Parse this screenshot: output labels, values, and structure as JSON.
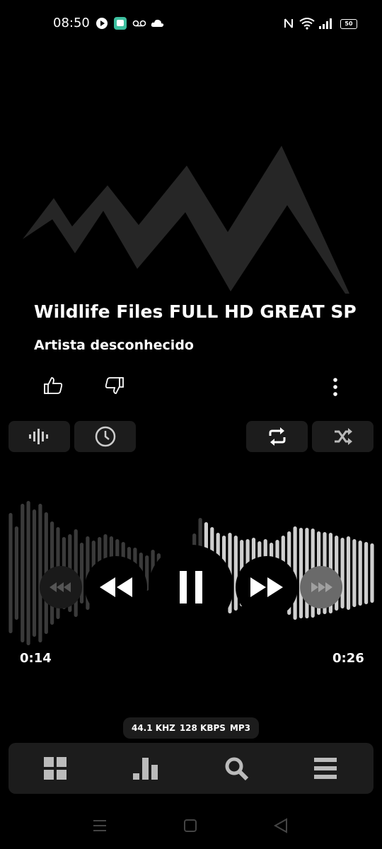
{
  "status_bar": {
    "time": "08:50",
    "battery": "50"
  },
  "track": {
    "title": "Wildlife Files FULL HD GREAT SP",
    "artist": "Artista desconhecido"
  },
  "playback": {
    "elapsed": "0:14",
    "total": "0:26",
    "progress": 0.54,
    "state": "playing"
  },
  "audio_info": {
    "sample_rate": "44.1 KHZ",
    "bitrate": "128 KBPS",
    "format": "MP3"
  },
  "colors": {
    "background": "#000000",
    "surface": "#1c1c1c",
    "played_wave": "#3a3a3a",
    "unplayed_wave": "#cfcfcf",
    "icon": "#cccccc"
  },
  "icons": {
    "like": "thumbs-up-icon",
    "dislike": "thumbs-down-icon",
    "more": "more-vertical-icon",
    "equalizer": "equalizer-icon",
    "timer": "clock-icon",
    "repeat": "repeat-icon",
    "shuffle": "shuffle-icon",
    "nav": [
      "grid-icon",
      "bar-chart-icon",
      "search-icon",
      "menu-icon"
    ]
  }
}
